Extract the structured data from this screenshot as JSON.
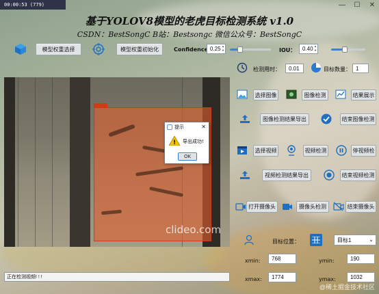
{
  "overlay_timestamp": "00:00:53 (779)",
  "window": {
    "minimize": "—",
    "maximize": "☐",
    "close": "✕"
  },
  "title": "基于YOLOV8模型的老虎目标检测系统 v1.0",
  "subtitle": "CSDN：BestSongC   B站：Bestsongc   微信公众号：BestSongC",
  "toolbar": {
    "select_weights": "模型权重选择",
    "init_weights": "模型权重初始化",
    "confidence_label": "Confidence:",
    "confidence_value": "0.25",
    "confidence_level": 0.25,
    "iou_label": "IOU：",
    "iou_value": "0.40",
    "iou_level": 0.4
  },
  "stats": {
    "time_label": "检测用时：",
    "time_value": "0.01",
    "count_label": "目标数量：",
    "count_value": "1"
  },
  "image_row": {
    "select": "选择图像",
    "detect": "图像检测",
    "show": "结果展示"
  },
  "image_export_row": {
    "export": "图像检测结果导出",
    "end": "结束图像检测"
  },
  "video_row": {
    "select": "选择视频",
    "detect": "视频检测",
    "pause": "停视频检"
  },
  "video_export_row": {
    "export": "视频检测结果导出",
    "end": "结束视频检测"
  },
  "camera_row": {
    "open": "打开摄像头",
    "detect": "摄像头检测",
    "end": "结束摄像头"
  },
  "position": {
    "label": "目标位置：",
    "target_select": "目标1",
    "xmin_label": "xmin:",
    "xmin_value": "768",
    "ymin_label": "ymin:",
    "ymin_value": "190",
    "xmax_label": "xmax:",
    "xmax_value": "1774",
    "ymax_label": "ymax:",
    "ymax_value": "1032"
  },
  "dialog": {
    "title": "提示",
    "message": "导出成功!",
    "ok": "OK",
    "close": "✕"
  },
  "status_text": "正在检测视频! ! !",
  "video_watermark": "clideo.com",
  "site_watermark": "@稀土掘金技术社区",
  "colors": {
    "accent": "#3f7fd6",
    "detection_box": "#d03b16"
  }
}
